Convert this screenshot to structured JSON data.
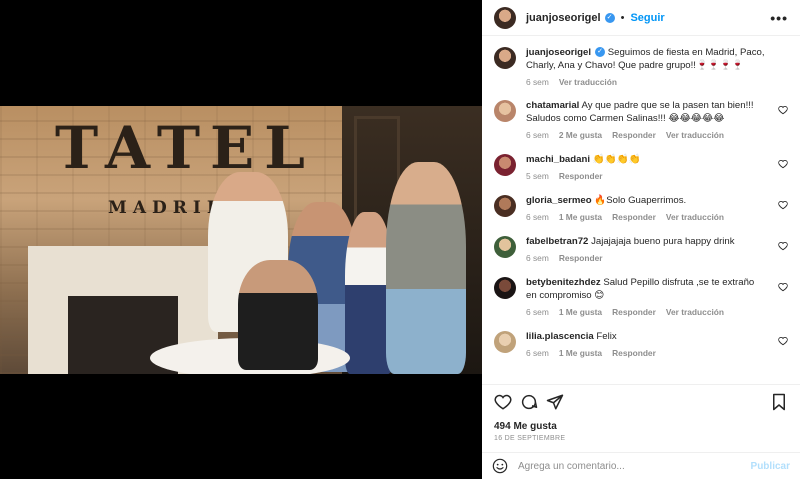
{
  "post": {
    "username": "juanjoseorigel",
    "follow_label": "Seguir",
    "separator": "•",
    "more_label": "•••",
    "photo_sign": "TATEL",
    "photo_sign_sub": "MADRID"
  },
  "caption": {
    "username": "juanjoseorigel",
    "text": "Seguimos de fiesta en Madrid, Paco, Charly, Ana y Chavo! Que padre grupo!!🍷🍷🍷🍷",
    "time": "6 sem",
    "translate": "Ver traducción"
  },
  "comments": [
    {
      "username": "chatamarial",
      "text": "Ay que padre que se la pasen tan bien!!! Saludos como Carmen Salinas!!! 😂😂😂😂😂",
      "time": "6 sem",
      "likes": "2 Me gusta",
      "reply": "Responder",
      "translate": "Ver traducción"
    },
    {
      "username": "machi_badani",
      "text": "👏👏👏👏",
      "time": "5 sem",
      "likes": "",
      "reply": "Responder",
      "translate": ""
    },
    {
      "username": "gloria_sermeo",
      "text": "🔥Solo Guaperrimos.",
      "time": "6 sem",
      "likes": "1 Me gusta",
      "reply": "Responder",
      "translate": "Ver traducción"
    },
    {
      "username": "fabelbetran72",
      "text": "Jajajajaja bueno pura happy drink",
      "time": "6 sem",
      "likes": "",
      "reply": "Responder",
      "translate": ""
    },
    {
      "username": "betybenitezhdez",
      "text": "Salud Pepillo disfruta ,se te extraño en compromiso 😊",
      "time": "6 sem",
      "likes": "1 Me gusta",
      "reply": "Responder",
      "translate": "Ver traducción"
    },
    {
      "username": "lilia.plascencia",
      "text": "Felix",
      "time": "6 sem",
      "likes": "1 Me gusta",
      "reply": "Responder",
      "translate": ""
    }
  ],
  "actions": {
    "likes": "494 Me gusta",
    "date": "16 DE SEPTIEMBRE"
  },
  "add_comment": {
    "placeholder": "Agrega un comentario...",
    "publish": "Publicar"
  }
}
